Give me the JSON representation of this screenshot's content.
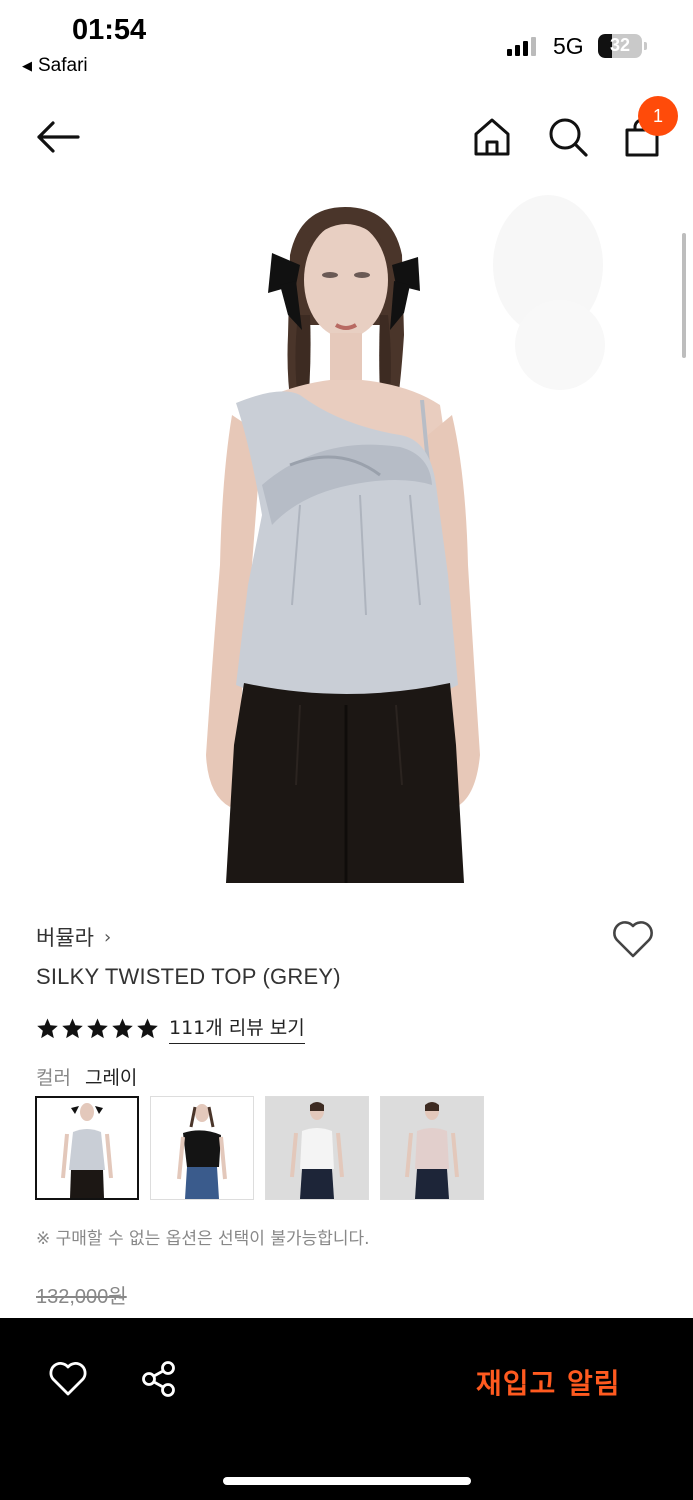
{
  "status_bar": {
    "time": "01:54",
    "back_app": "Safari",
    "network": "5G",
    "battery_percent": "32",
    "battery_level": 0.32
  },
  "header": {
    "cart_count": "1",
    "icons": [
      "back-arrow-icon",
      "home-icon",
      "search-icon",
      "shopping-bag-icon"
    ]
  },
  "product": {
    "brand": "버뮬라",
    "brand_chevron": "›",
    "name": "SILKY TWISTED TOP (GREY)",
    "rating_stars": 5,
    "review_link": "111개 리뷰 보기",
    "color_label": "컬러",
    "color_value": "그레이",
    "swatches": [
      "grey",
      "black",
      "white",
      "pink"
    ],
    "selected_swatch": "grey",
    "notice": "※ 구매할 수 없는 옵션은 선택이 불가능합니다.",
    "original_price": "132,000원"
  },
  "bottom_bar": {
    "restock_label": "재입고 알림",
    "accent": "#ff5a1f"
  },
  "colors": {
    "badge": "#ff4b0a",
    "top_grey": "#c9ced6",
    "pants_black": "#1c1714"
  }
}
